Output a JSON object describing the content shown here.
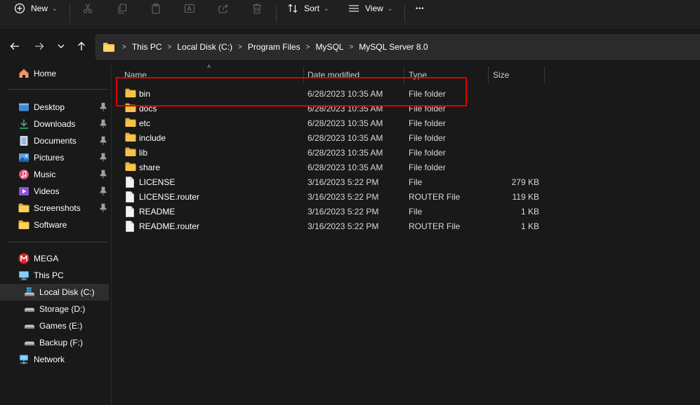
{
  "toolbar": {
    "new_label": "New",
    "sort_label": "Sort",
    "view_label": "View",
    "more_label": "•••"
  },
  "address": {
    "crumbs": [
      "This PC",
      "Local Disk (C:)",
      "Program Files",
      "MySQL",
      "MySQL Server 8.0"
    ]
  },
  "sidebar": {
    "items": [
      {
        "label": "Home"
      },
      {
        "label": "Desktop"
      },
      {
        "label": "Downloads"
      },
      {
        "label": "Documents"
      },
      {
        "label": "Pictures"
      },
      {
        "label": "Music"
      },
      {
        "label": "Videos"
      },
      {
        "label": "Screenshots"
      },
      {
        "label": "Software"
      },
      {
        "label": "MEGA"
      },
      {
        "label": "This PC"
      },
      {
        "label": "Local Disk (C:)"
      },
      {
        "label": "Storage (D:)"
      },
      {
        "label": "Games (E:)"
      },
      {
        "label": "Backup (F:)"
      },
      {
        "label": "Network"
      }
    ]
  },
  "columns": {
    "name": "Name",
    "date": "Date modified",
    "type": "Type",
    "size": "Size"
  },
  "files": [
    {
      "name": "bin",
      "date": "6/28/2023 10:35 AM",
      "type": "File folder",
      "size": ""
    },
    {
      "name": "docs",
      "date": "6/28/2023 10:35 AM",
      "type": "File folder",
      "size": ""
    },
    {
      "name": "etc",
      "date": "6/28/2023 10:35 AM",
      "type": "File folder",
      "size": ""
    },
    {
      "name": "include",
      "date": "6/28/2023 10:35 AM",
      "type": "File folder",
      "size": ""
    },
    {
      "name": "lib",
      "date": "6/28/2023 10:35 AM",
      "type": "File folder",
      "size": ""
    },
    {
      "name": "share",
      "date": "6/28/2023 10:35 AM",
      "type": "File folder",
      "size": ""
    },
    {
      "name": "LICENSE",
      "date": "3/16/2023 5:22 PM",
      "type": "File",
      "size": "279 KB"
    },
    {
      "name": "LICENSE.router",
      "date": "3/16/2023 5:22 PM",
      "type": "ROUTER File",
      "size": "119 KB"
    },
    {
      "name": "README",
      "date": "3/16/2023 5:22 PM",
      "type": "File",
      "size": "1 KB"
    },
    {
      "name": "README.router",
      "date": "3/16/2023 5:22 PM",
      "type": "ROUTER File",
      "size": "1 KB"
    }
  ],
  "colors": {
    "folder": "#f5c34a",
    "highlight": "#e10000"
  }
}
